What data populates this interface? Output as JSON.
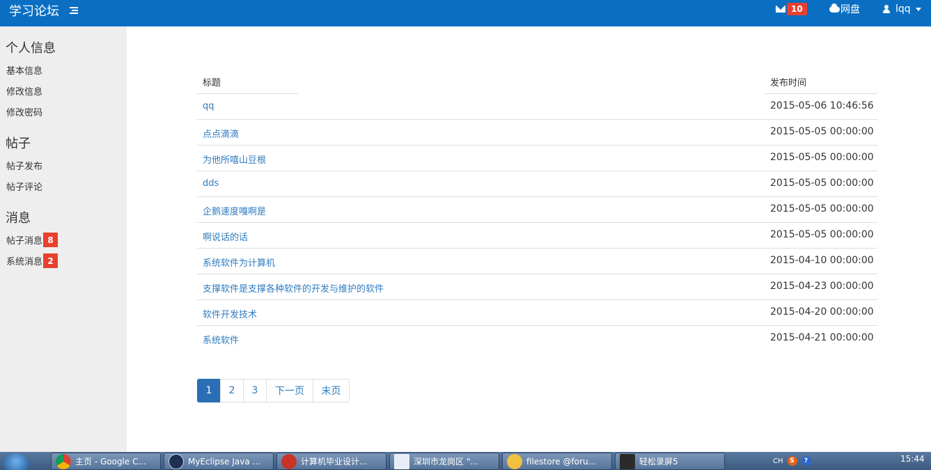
{
  "header": {
    "brand": "学习论坛",
    "mail_count": "10",
    "disk_label": "网盘",
    "username": "lqq"
  },
  "sidebar": {
    "sections": [
      {
        "heading": "个人信息",
        "items": [
          "基本信息",
          "修改信息",
          "修改密码"
        ]
      },
      {
        "heading": "帖子",
        "items": [
          "帖子发布",
          "帖子评论"
        ]
      },
      {
        "heading": "消息",
        "items": [
          "帖子消息",
          "系统消息"
        ]
      }
    ],
    "badges": {
      "post_messages": "8",
      "system_messages": "2"
    }
  },
  "table": {
    "columns": [
      "标题",
      "发布时间"
    ],
    "rows": [
      {
        "title": "qq",
        "time": "2015-05-06 10:46:56"
      },
      {
        "title": "点点滴滴",
        "time": "2015-05-05 00:00:00"
      },
      {
        "title": "为他所嘻山豆根",
        "time": "2015-05-05 00:00:00"
      },
      {
        "title": "dds",
        "time": "2015-05-05 00:00:00"
      },
      {
        "title": "企鹅速度嘎啊是",
        "time": "2015-05-05 00:00:00"
      },
      {
        "title": "啊说话的话",
        "time": "2015-05-05 00:00:00"
      },
      {
        "title": "系统软件为计算机",
        "time": "2015-04-10 00:00:00"
      },
      {
        "title": "支撑软件是支撑各种软件的开发与维护的软件",
        "time": "2015-04-23 00:00:00"
      },
      {
        "title": "软件开发技术",
        "time": "2015-04-20 00:00:00"
      },
      {
        "title": "系统软件",
        "time": "2015-04-21 00:00:00"
      }
    ]
  },
  "pagination": [
    "1",
    "2",
    "3",
    "下一页",
    "末页"
  ],
  "taskbar": {
    "buttons": [
      "主页 - Google C...",
      "MyEclipse Java ...",
      "计算机毕业设计...",
      "深圳市龙岗区 \"...",
      "filestore @foru...",
      "轻松录屏5"
    ],
    "tray_lang": "CH",
    "tray_s": "S",
    "tray_help": "?",
    "clock": "15:44"
  }
}
